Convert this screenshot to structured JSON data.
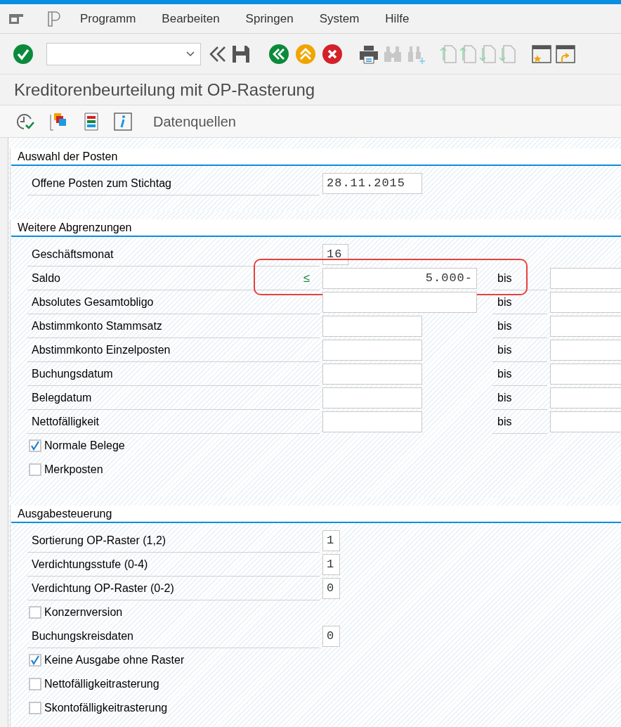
{
  "menu": [
    "Programm",
    "Bearbeiten",
    "Springen",
    "System",
    "Hilfe"
  ],
  "title": "Kreditorenbeurteilung mit OP-Rasterung",
  "app_toolbar": {
    "label": "Datenquellen"
  },
  "sections": [
    {
      "title": "Auswahl der Posten",
      "rows": [
        {
          "kind": "field",
          "label": "Offene Posten zum Stichtag",
          "input": {
            "kind": "date",
            "value": "28.11.2015"
          },
          "range": false
        }
      ]
    },
    {
      "title": "Weitere Abgrenzungen",
      "rows": [
        {
          "kind": "field",
          "label": "Geschäftsmonat",
          "input": {
            "kind": "period",
            "value": "16"
          },
          "range": false
        },
        {
          "kind": "field",
          "label": "Saldo",
          "operator": "≤",
          "input": {
            "kind": "amount",
            "value": "5.000-"
          },
          "range": true,
          "to_label": "bis",
          "highlighted": true
        },
        {
          "kind": "field",
          "label": "Absolutes Gesamtobligo",
          "input": {
            "kind": "amount"
          },
          "range": true,
          "to_label": "bis"
        },
        {
          "kind": "field",
          "label": "Abstimmkonto Stammsatz",
          "input": {
            "kind": "account"
          },
          "range": true,
          "to_label": "bis"
        },
        {
          "kind": "field",
          "label": "Abstimmkonto Einzelposten",
          "input": {
            "kind": "account"
          },
          "range": true,
          "to_label": "bis"
        },
        {
          "kind": "field",
          "label": "Buchungsdatum",
          "input": {
            "kind": "account"
          },
          "range": true,
          "to_label": "bis"
        },
        {
          "kind": "field",
          "label": "Belegdatum",
          "input": {
            "kind": "account"
          },
          "range": true,
          "to_label": "bis"
        },
        {
          "kind": "field",
          "label": "Nettofälligkeit",
          "input": {
            "kind": "account"
          },
          "range": true,
          "to_label": "bis"
        },
        {
          "kind": "checkbox",
          "label": "Normale Belege",
          "checked": true
        },
        {
          "kind": "checkbox",
          "label": "Merkposten",
          "checked": false
        }
      ]
    },
    {
      "title": "Ausgabesteuerung",
      "rows": [
        {
          "kind": "field",
          "label": "Sortierung OP-Raster (1,2)",
          "input": {
            "kind": "digit",
            "value": "1"
          },
          "range": false
        },
        {
          "kind": "field",
          "label": "Verdichtungsstufe (0-4)",
          "input": {
            "kind": "digit",
            "value": "1"
          },
          "range": false
        },
        {
          "kind": "field",
          "label": "Verdichtung OP-Raster (0-2)",
          "input": {
            "kind": "digit",
            "value": "0"
          },
          "range": false
        },
        {
          "kind": "checkbox",
          "label": "Konzernversion",
          "checked": false
        },
        {
          "kind": "field",
          "label": "Buchungskreisdaten",
          "input": {
            "kind": "digit",
            "value": "0"
          },
          "range": false
        },
        {
          "kind": "checkbox",
          "label": "Keine Ausgabe ohne Raster",
          "checked": true
        },
        {
          "kind": "checkbox",
          "label": "Nettofälligkeitrasterung",
          "checked": false
        },
        {
          "kind": "checkbox",
          "label": "Skontofälligkeitrasterung",
          "checked": false
        }
      ]
    }
  ]
}
